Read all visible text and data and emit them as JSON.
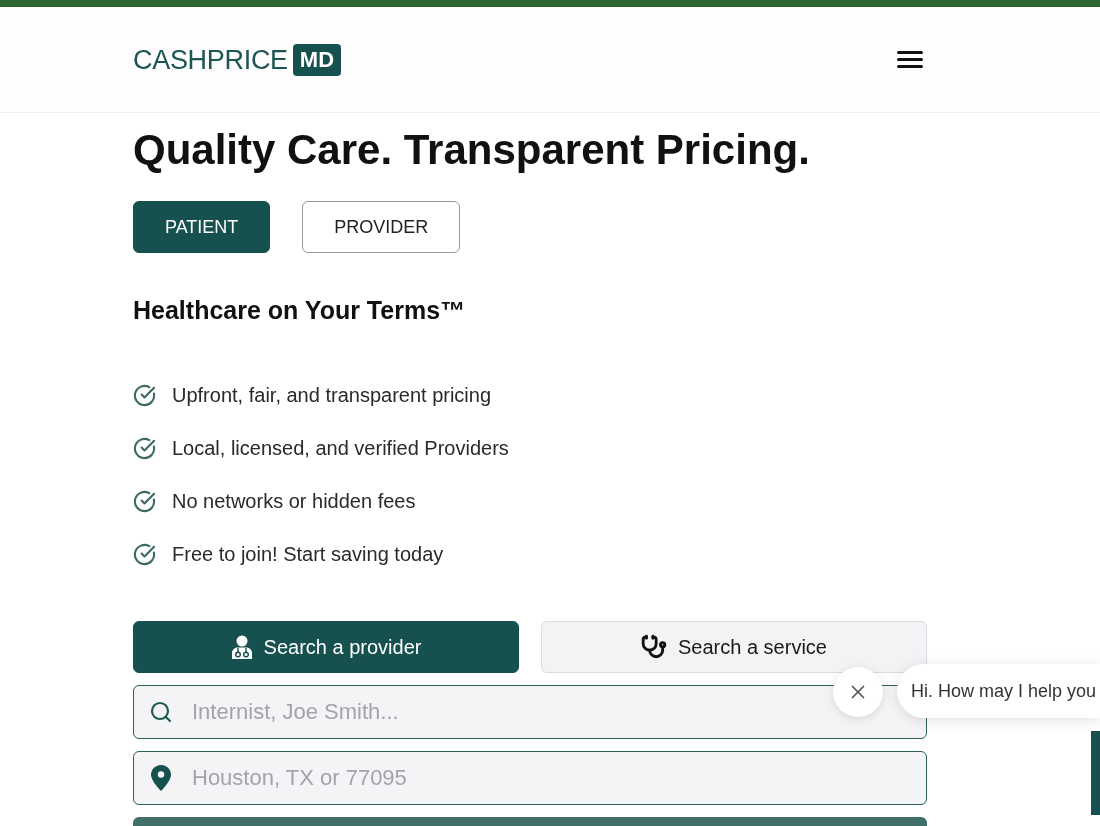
{
  "header": {
    "logo": {
      "wordmark": "CASHPRICE",
      "mark": "MD"
    }
  },
  "hero": {
    "title": "Quality Care. Transparent Pricing."
  },
  "audience_tabs": [
    {
      "label": "PATIENT",
      "selected": true
    },
    {
      "label": "PROVIDER",
      "selected": false
    }
  ],
  "tagline": "Healthcare on Your Terms™",
  "features": [
    "Upfront, fair, and transparent pricing",
    "Local, licensed, and verified Providers",
    "No networks or hidden fees",
    "Free to join! Start saving today"
  ],
  "search_modes": [
    {
      "kind": "provider",
      "label": "Search a provider",
      "selected": true
    },
    {
      "kind": "service",
      "label": "Search a service",
      "selected": false
    }
  ],
  "fields": [
    {
      "kind": "search",
      "placeholder": "Internist, Joe Smith..."
    },
    {
      "kind": "location",
      "placeholder": "Houston, TX or 77095"
    }
  ],
  "chat": {
    "greeting": "Hi. How may I help you"
  }
}
